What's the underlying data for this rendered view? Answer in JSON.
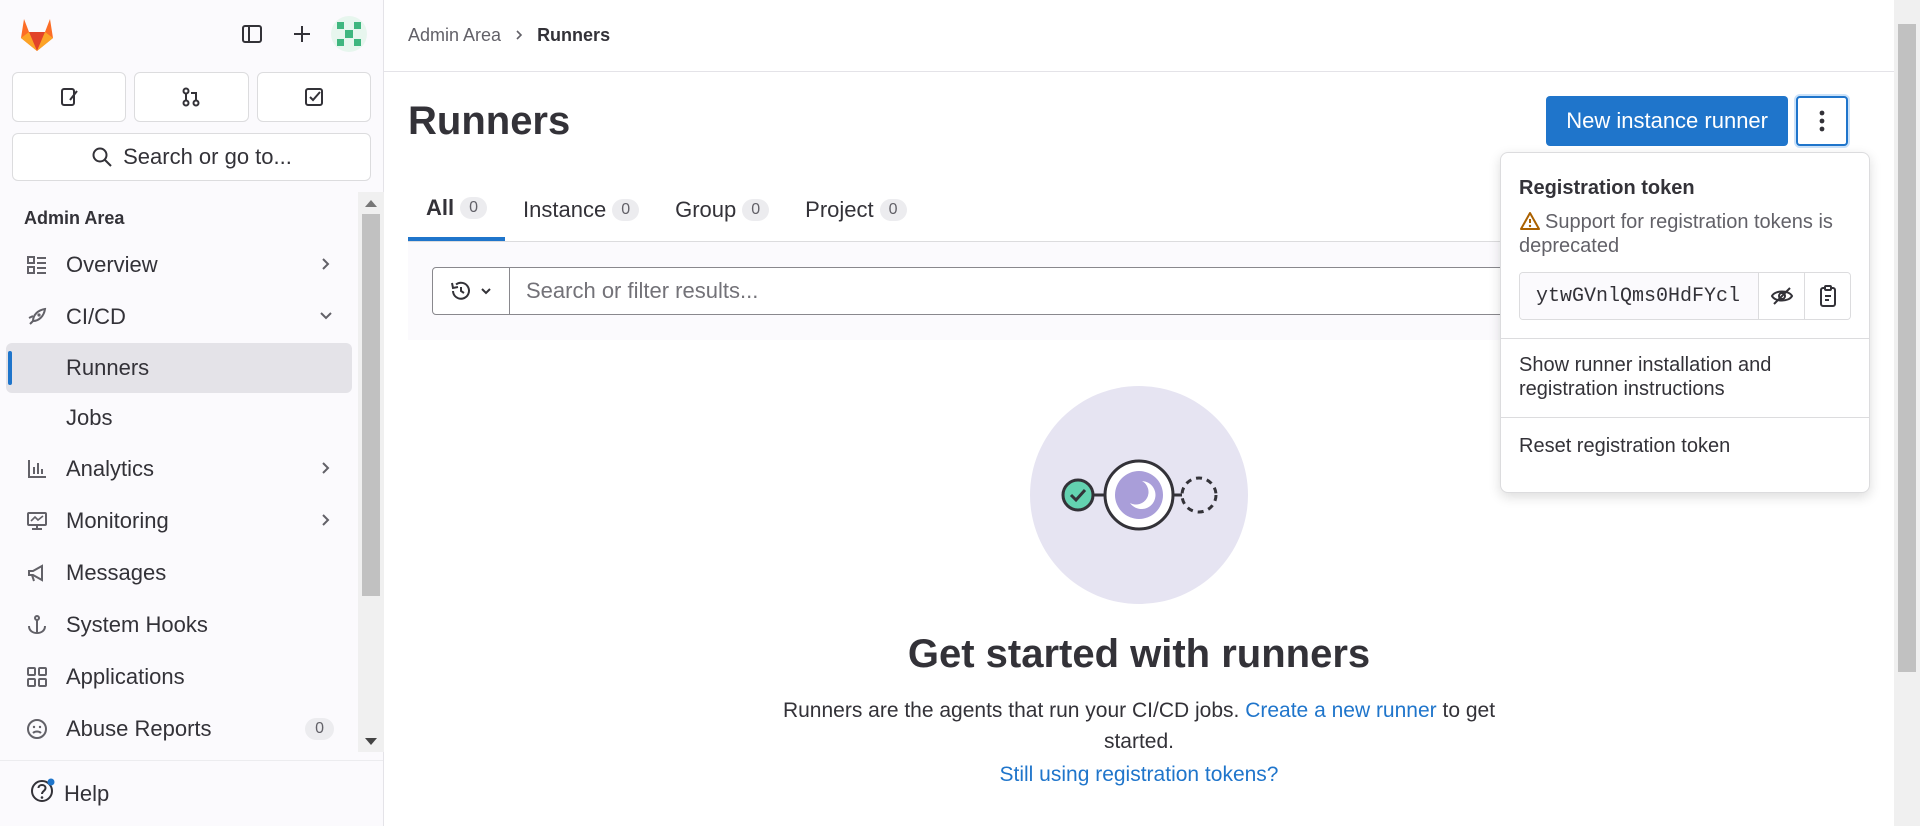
{
  "sidebar": {
    "search_label": "Search or go to...",
    "nav_title": "Admin Area",
    "items": [
      {
        "label": "Overview"
      },
      {
        "label": "CI/CD"
      },
      {
        "label": "Runners"
      },
      {
        "label": "Jobs"
      },
      {
        "label": "Analytics"
      },
      {
        "label": "Monitoring"
      },
      {
        "label": "Messages"
      },
      {
        "label": "System Hooks"
      },
      {
        "label": "Applications"
      },
      {
        "label": "Abuse Reports",
        "count": "0"
      }
    ],
    "help_label": "Help"
  },
  "breadcrumb": {
    "parent": "Admin Area",
    "current": "Runners"
  },
  "page": {
    "title": "Runners",
    "new_runner_label": "New instance runner"
  },
  "tabs": [
    {
      "label": "All",
      "count": "0"
    },
    {
      "label": "Instance",
      "count": "0"
    },
    {
      "label": "Group",
      "count": "0"
    },
    {
      "label": "Project",
      "count": "0"
    }
  ],
  "filter": {
    "placeholder": "Search or filter results..."
  },
  "empty_state": {
    "title": "Get started with runners",
    "desc_before": "Runners are the agents that run your CI/CD jobs. ",
    "desc_link": "Create a new runner",
    "desc_after": " to get started.",
    "still_link": "Still using registration tokens?"
  },
  "dropdown": {
    "title": "Registration token",
    "warning": "Support for registration tokens is deprecated",
    "token_value": "ytwGVnlQms0HdFYcl",
    "show_instructions": "Show runner installation and registration instructions",
    "reset_token": "Reset registration token"
  },
  "colors": {
    "accent": "#1f75cb",
    "brand_orange": "#fc6d26"
  }
}
